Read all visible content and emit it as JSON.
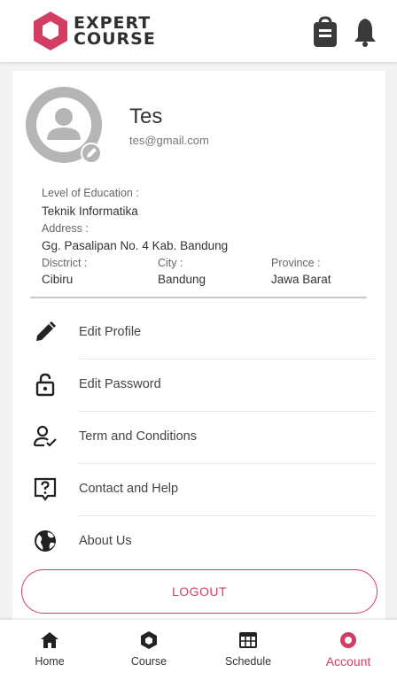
{
  "header": {
    "logo_line1": "EXPERT",
    "logo_line2": "COURSE",
    "icons": [
      "bag-icon",
      "bell-icon"
    ]
  },
  "profile": {
    "name": "Tes",
    "email": "tes@gmail.com",
    "education_label": "Level of Education :",
    "education_value": "Teknik Informatika",
    "address_label": "Address :",
    "address_value": "Gg. Pasalipan No. 4 Kab. Bandung",
    "district_label": "Disctrict :",
    "district_value": "Cibiru",
    "city_label": "City :",
    "city_value": "Bandung",
    "province_label": "Province :",
    "province_value": "Jawa Barat"
  },
  "menu": [
    {
      "label": "Edit Profile",
      "icon": "pencil-icon"
    },
    {
      "label": "Edit Password",
      "icon": "lock-icon"
    },
    {
      "label": "Term and Conditions",
      "icon": "user-check-icon"
    },
    {
      "label": "Contact and Help",
      "icon": "help-icon"
    },
    {
      "label": "About Us",
      "icon": "globe-icon"
    }
  ],
  "logout_label": "LOGOUT",
  "nav": [
    {
      "label": "Home",
      "icon": "home-icon"
    },
    {
      "label": "Course",
      "icon": "hexagon-icon"
    },
    {
      "label": "Schedule",
      "icon": "calendar-icon"
    },
    {
      "label": "Account",
      "icon": "account-icon",
      "active": true
    }
  ],
  "colors": {
    "accent": "#d43d63",
    "text_dark": "#333333",
    "text_muted": "#666666",
    "background": "#f2f2f2"
  }
}
